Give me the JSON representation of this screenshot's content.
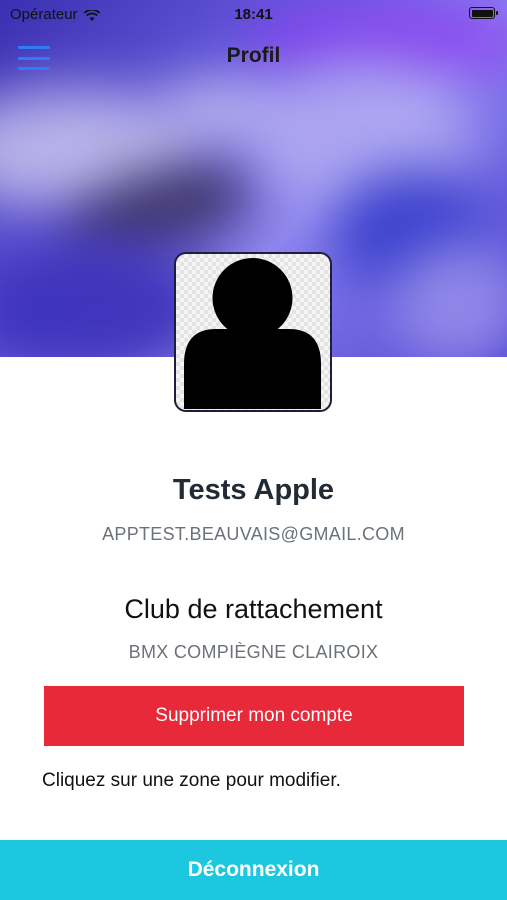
{
  "status_bar": {
    "carrier": "Opérateur",
    "time": "18:41",
    "icons": [
      "wifi-icon",
      "battery-icon"
    ]
  },
  "nav": {
    "title": "Profil",
    "menu_icon": "hamburger-menu-icon"
  },
  "profile": {
    "avatar_icon": "user-silhouette-icon",
    "name": "Tests Apple",
    "email": "APPTEST.BEAUVAIS@GMAIL.COM",
    "club_title": "Club de rattachement",
    "club_name": "BMX COMPIÈGNE CLAIROIX"
  },
  "actions": {
    "delete_account": "Supprimer mon compte",
    "hint": "Cliquez sur une zone pour modifier.",
    "logout": "Déconnexion"
  },
  "colors": {
    "delete_button": "#e8293a",
    "logout_button": "#1ec7e0",
    "menu_icon": "#2f7df6"
  }
}
